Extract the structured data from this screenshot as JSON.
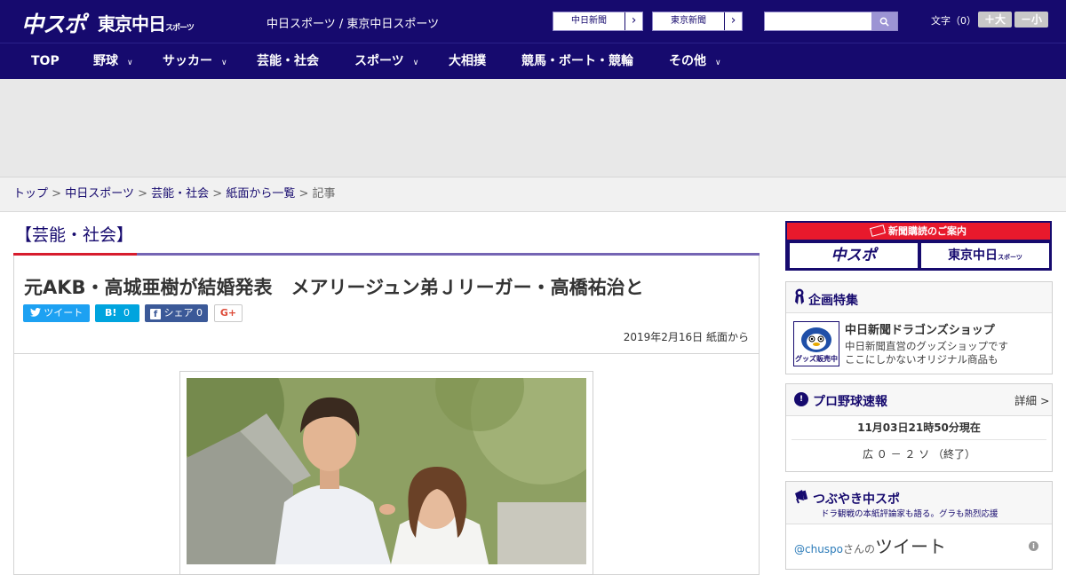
{
  "header": {
    "logo_main": "中スポ",
    "logo_tokyo": "東京中日",
    "logo_tokyo_small": "スポーツ",
    "site_title": "中日スポーツ / 東京中日スポーツ",
    "portal_buttons": [
      "中日新聞",
      "東京新聞"
    ],
    "search_placeholder": "",
    "font_size_label": "文字（0）",
    "font_larger": "＋大",
    "font_smaller": "－小"
  },
  "nav": {
    "items": [
      {
        "label": "TOP",
        "has_dropdown": false
      },
      {
        "label": "野球",
        "has_dropdown": true
      },
      {
        "label": "サッカー",
        "has_dropdown": true
      },
      {
        "label": "芸能・社会",
        "has_dropdown": false
      },
      {
        "label": "スポーツ",
        "has_dropdown": true
      },
      {
        "label": "大相撲",
        "has_dropdown": false
      },
      {
        "label": "競馬・ボート・競輪",
        "has_dropdown": false
      },
      {
        "label": "その他",
        "has_dropdown": true
      }
    ]
  },
  "breadcrumb": {
    "items": [
      "トップ",
      "中日スポーツ",
      "芸能・社会",
      "紙面から一覧"
    ],
    "current": "記事",
    "separator": ">"
  },
  "article": {
    "category": "【芸能・社会】",
    "headline": "元AKB・高城亜樹が結婚発表　メアリージュン弟Ｊリーガー・高橋祐治と",
    "share": {
      "tweet": "ツイート",
      "hatena_icon": "B!",
      "hatena_count": "0",
      "fb_label": "シェア",
      "fb_count": "0",
      "gplus": "G+"
    },
    "date": "2019年2月16日",
    "source": "紙面から"
  },
  "sidebar": {
    "subscribe_title": "新聞購読のご案内",
    "subscribe_logos": [
      "中スポ",
      "東京中日"
    ],
    "subscribe_logo_small": "スポーツ",
    "feature": {
      "title": "企画特集",
      "shop_title": "中日新聞ドラゴンズショップ",
      "shop_desc1": "中日新聞直営のグッズショップです",
      "shop_desc2": "ここにしかないオリジナル商品も",
      "thumb_label": "グッズ販売中"
    },
    "baseball": {
      "title": "プロ野球速報",
      "more": "詳細 >",
      "timestamp": "11月03日21時50分現在",
      "score": "広 ０ － ２ ソ （終了）"
    },
    "tweets": {
      "title": "つぶやき中スポ",
      "subtitle": "ドラ観戦の本紙評論家も語る。グラも熱烈応援",
      "handle": "@chuspo",
      "handle_suffix": "さんの",
      "tweet_word": "ツイート"
    }
  },
  "colors": {
    "brand_navy": "#160a6e",
    "accent_red": "#d71c2d",
    "twitter": "#1da1f2",
    "hatena": "#00a4de",
    "facebook": "#3b5998"
  }
}
